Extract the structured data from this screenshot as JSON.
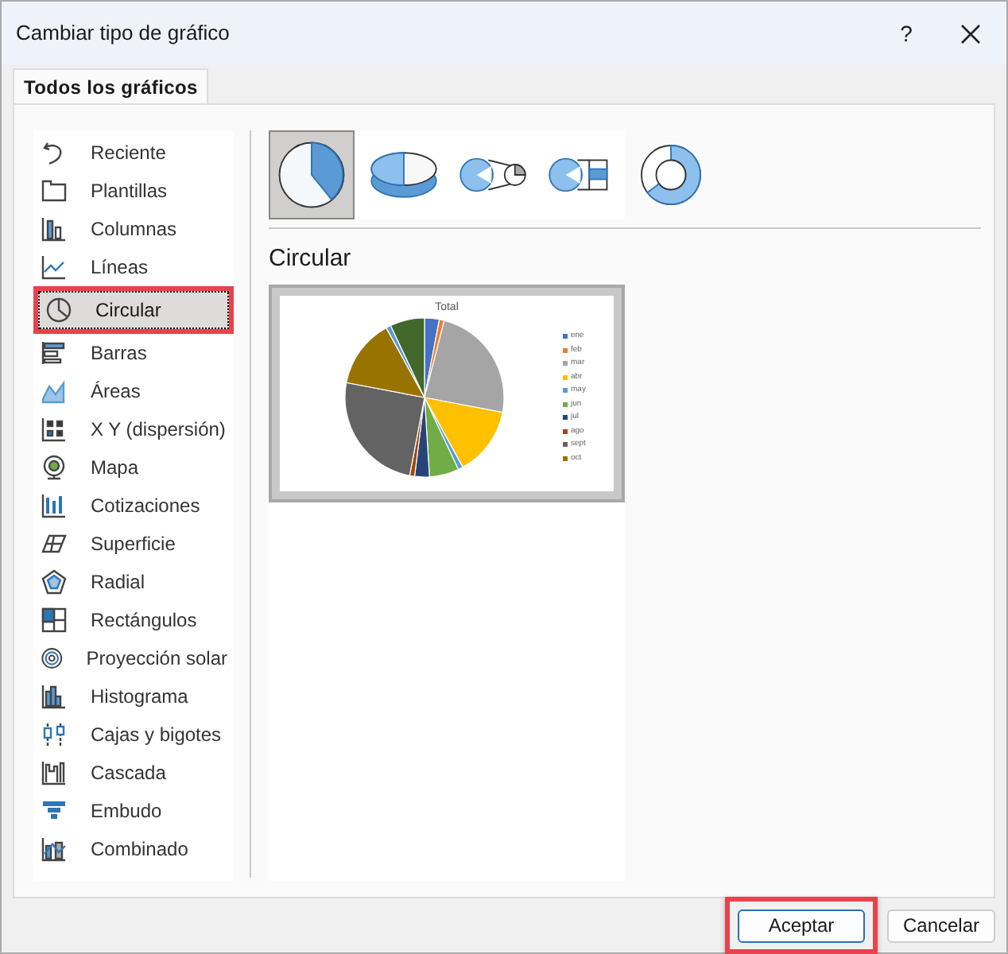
{
  "window": {
    "title": "Cambiar tipo de gráfico",
    "help": "?"
  },
  "tabs": [
    {
      "label": "Todos los gráficos",
      "selected": true
    }
  ],
  "sidebar": {
    "items": [
      {
        "label": "Reciente",
        "selected": false,
        "highlighted": false
      },
      {
        "label": "Plantillas",
        "selected": false,
        "highlighted": false
      },
      {
        "label": "Columnas",
        "selected": false,
        "highlighted": false
      },
      {
        "label": "Líneas",
        "selected": false,
        "highlighted": false
      },
      {
        "label": "Circular",
        "selected": true,
        "highlighted": true
      },
      {
        "label": "Barras",
        "selected": false,
        "highlighted": false
      },
      {
        "label": "Áreas",
        "selected": false,
        "highlighted": false
      },
      {
        "label": "X Y (dispersión)",
        "selected": false,
        "highlighted": false
      },
      {
        "label": "Mapa",
        "selected": false,
        "highlighted": false
      },
      {
        "label": "Cotizaciones",
        "selected": false,
        "highlighted": false
      },
      {
        "label": "Superficie",
        "selected": false,
        "highlighted": false
      },
      {
        "label": "Radial",
        "selected": false,
        "highlighted": false
      },
      {
        "label": "Rectángulos",
        "selected": false,
        "highlighted": false
      },
      {
        "label": "Proyección solar",
        "selected": false,
        "highlighted": false
      },
      {
        "label": "Histograma",
        "selected": false,
        "highlighted": false
      },
      {
        "label": "Cajas y bigotes",
        "selected": false,
        "highlighted": false
      },
      {
        "label": "Cascada",
        "selected": false,
        "highlighted": false
      },
      {
        "label": "Embudo",
        "selected": false,
        "highlighted": false
      },
      {
        "label": "Combinado",
        "selected": false,
        "highlighted": false
      }
    ]
  },
  "subtypes": [
    {
      "kind": "pie",
      "selected": true
    },
    {
      "kind": "pie3d",
      "selected": false
    },
    {
      "kind": "pieofpie",
      "selected": false
    },
    {
      "kind": "barofpie",
      "selected": false
    },
    {
      "kind": "donut",
      "selected": false
    }
  ],
  "section_title": "Circular",
  "preview": {
    "title": "Total",
    "legend": [
      {
        "label": "ene",
        "color": "#4472c4"
      },
      {
        "label": "feb",
        "color": "#ed7d31"
      },
      {
        "label": "mar",
        "color": "#a5a5a5"
      },
      {
        "label": "abr",
        "color": "#ffc000"
      },
      {
        "label": "may",
        "color": "#5b9bd5"
      },
      {
        "label": "jun",
        "color": "#70ad47"
      },
      {
        "label": "jul",
        "color": "#264478"
      },
      {
        "label": "ago",
        "color": "#9e480e"
      },
      {
        "label": "sept",
        "color": "#636363"
      },
      {
        "label": "oct",
        "color": "#997300"
      }
    ]
  },
  "buttons": [
    {
      "label": "Aceptar",
      "kind": "primary",
      "highlighted": true
    },
    {
      "label": "Cancelar",
      "kind": "secondary",
      "highlighted": false
    }
  ]
}
